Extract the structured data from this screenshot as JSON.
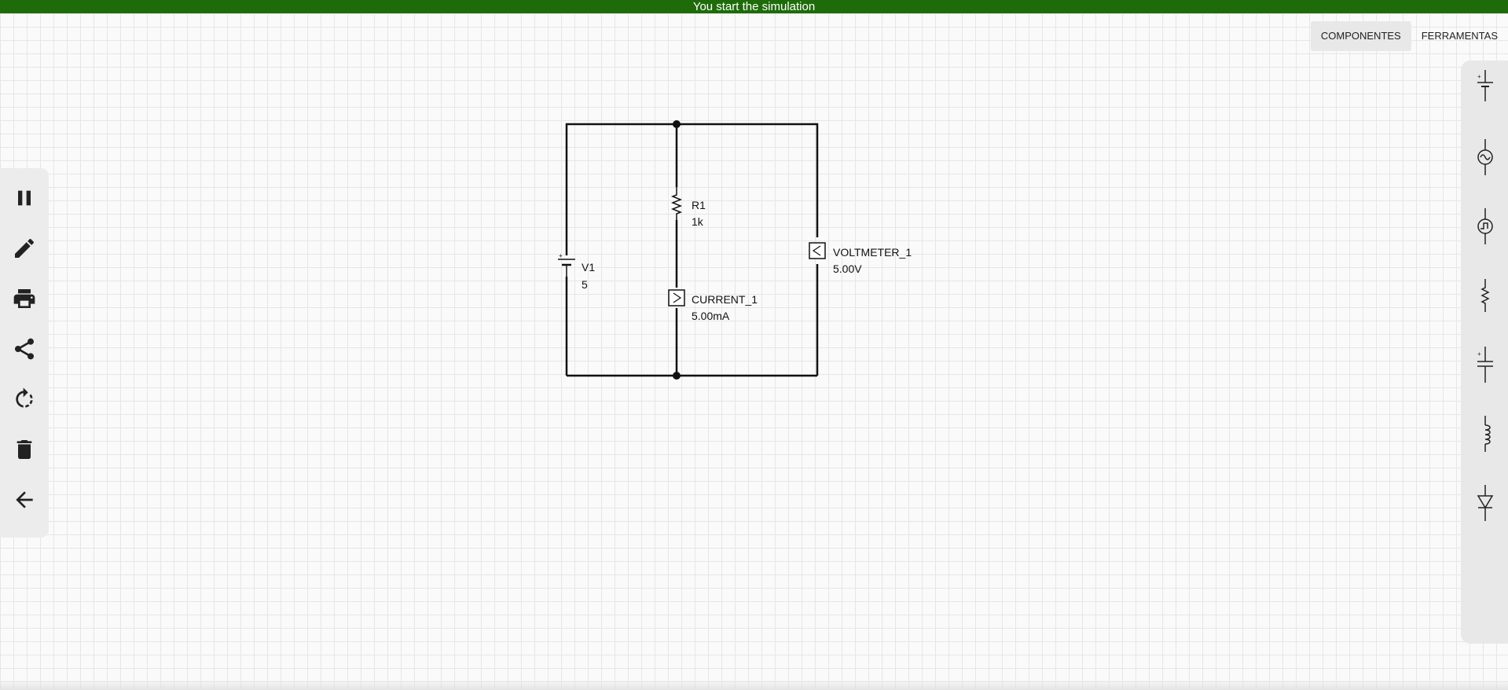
{
  "banner": {
    "text": "You start the simulation",
    "color": "#1e6b0a"
  },
  "left_toolbar": [
    {
      "name": "pause-icon",
      "label": "Pause"
    },
    {
      "name": "pencil-icon",
      "label": "Edit"
    },
    {
      "name": "print-icon",
      "label": "Print"
    },
    {
      "name": "share-icon",
      "label": "Share"
    },
    {
      "name": "rotate-icon",
      "label": "Rotate"
    },
    {
      "name": "trash-icon",
      "label": "Delete"
    },
    {
      "name": "arrow-left-icon",
      "label": "Back"
    }
  ],
  "tabs": {
    "components": "COMPONENTES",
    "tools": "FERRAMENTAS",
    "active": "COMPONENTES"
  },
  "component_palette": [
    "dc-voltage-source-icon",
    "ac-voltage-source-icon",
    "pulse-source-icon",
    "resistor-icon",
    "capacitor-icon",
    "inductor-icon",
    "diode-icon"
  ],
  "circuit": {
    "components": [
      {
        "id": "v1",
        "name": "V1",
        "value": "5",
        "type": "dc-voltage-source"
      },
      {
        "id": "r1",
        "name": "R1",
        "value": "1k",
        "type": "resistor"
      },
      {
        "id": "ammeter",
        "name": "CURRENT_1",
        "value": "5.00mA",
        "type": "ammeter"
      },
      {
        "id": "voltmeter",
        "name": "VOLTMETER_1",
        "value": "5.00V",
        "type": "voltmeter"
      }
    ]
  }
}
